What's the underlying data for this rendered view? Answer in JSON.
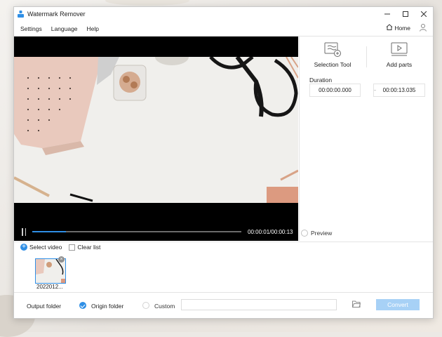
{
  "window": {
    "title": "Watermark Remover",
    "controls": {
      "minimize": "minimize-icon",
      "maximize": "maximize-icon",
      "close": "close-icon"
    }
  },
  "menu": {
    "items": [
      "Settings",
      "Language",
      "Help"
    ],
    "home_label": "Home"
  },
  "player": {
    "timecode": "00:00:01/00:00:13",
    "progress": 0.16
  },
  "panel": {
    "selection_tool_label": "Selection Tool",
    "add_parts_label": "Add parts",
    "duration_label": "Duration",
    "start_time": "00:00:00.000",
    "end_time": "00:00:13.035",
    "preview_label": "Preview"
  },
  "file_list": {
    "select_video_label": "Select video",
    "clear_list_label": "Clear list",
    "items": [
      {
        "name": "2022012..."
      }
    ]
  },
  "output": {
    "folder_label": "Output folder",
    "origin_label": "Origin folder",
    "custom_label": "Custom",
    "custom_path": "",
    "convert_label": "Convert"
  },
  "colors": {
    "accent": "#2f8fe6",
    "convert_disabled": "#a7d1f6",
    "video_bg": "#000000"
  }
}
